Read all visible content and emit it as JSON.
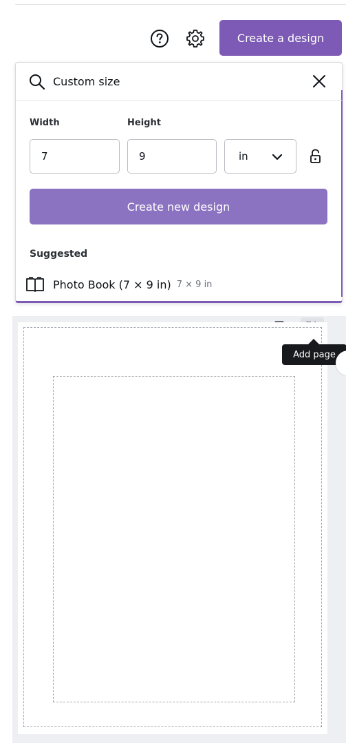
{
  "header": {
    "create_design_label": "Create a design",
    "help_icon": "question-circle-icon",
    "settings_icon": "gear-icon"
  },
  "panel": {
    "search": {
      "value": "Custom size",
      "search_icon": "search-icon",
      "clear_icon": "close-icon"
    },
    "width_label": "Width",
    "height_label": "Height",
    "width_value": "7",
    "height_value": "9",
    "unit_value": "in",
    "lock_icon": "unlocked-padlock-icon",
    "create_new_label": "Create new design",
    "suggested_label": "Suggested",
    "suggestions": [
      {
        "name": "Photo Book (7 × 9 in)",
        "dims": "7 × 9 in",
        "icon": "open-book-icon"
      }
    ]
  },
  "workspace": {
    "tooltip": "Add page",
    "duplicate_icon": "duplicate-page-icon",
    "add_page_icon": "add-page-icon"
  },
  "colors": {
    "accent": "#7d5ab5",
    "accent_light": "#8c73c2",
    "tooltip_bg": "#17191c",
    "workspace_bg": "#edeff2"
  }
}
